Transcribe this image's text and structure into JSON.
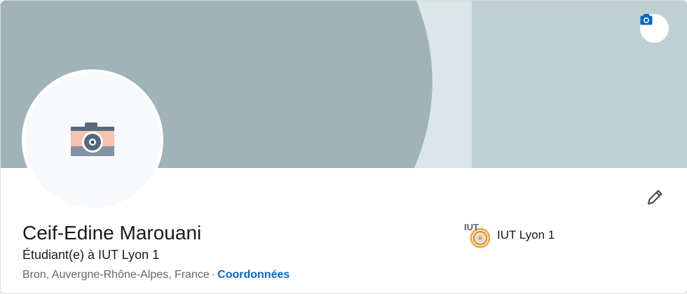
{
  "profile": {
    "name": "Ceif-Edine Marouani",
    "headline": "Étudiant(e) à IUT Lyon 1",
    "location": "Bron, Auvergne-Rhône-Alpes, France",
    "separator": "·",
    "contact_link": "Coordonnées"
  },
  "school": {
    "name": "IUT Lyon 1",
    "logo_text": "IUT"
  },
  "icons": {
    "banner_edit": "camera-icon",
    "avatar_placeholder": "camera-placeholder-icon",
    "edit_profile": "pencil-icon"
  },
  "colors": {
    "link": "#0a66c2",
    "banner_dark": "#a0b3b7",
    "banner_light": "#bed0d4",
    "banner_mid": "#dbe6e8"
  }
}
